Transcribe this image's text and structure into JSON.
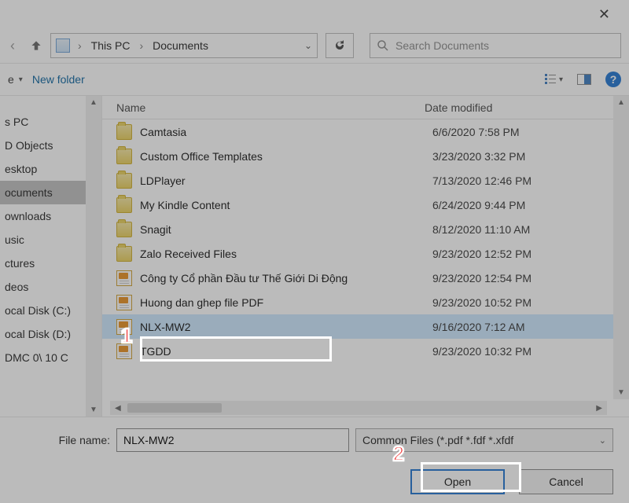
{
  "breadcrumb": {
    "root": "This PC",
    "current": "Documents"
  },
  "search": {
    "placeholder": "Search Documents"
  },
  "toolbar": {
    "organize_exists": true,
    "new_folder": "New folder"
  },
  "columns": {
    "name": "Name",
    "date": "Date modified"
  },
  "tree": {
    "items": [
      {
        "label": "s PC",
        "selected": false
      },
      {
        "label": "D Objects",
        "selected": false
      },
      {
        "label": "esktop",
        "selected": false
      },
      {
        "label": "ocuments",
        "selected": true
      },
      {
        "label": "ownloads",
        "selected": false
      },
      {
        "label": "usic",
        "selected": false
      },
      {
        "label": "ctures",
        "selected": false
      },
      {
        "label": "deos",
        "selected": false
      },
      {
        "label": "ocal Disk (C:)",
        "selected": false
      },
      {
        "label": "ocal Disk (D:)",
        "selected": false
      },
      {
        "label": "DMC 0\\ 10 C",
        "selected": false
      }
    ]
  },
  "files": [
    {
      "type": "folder",
      "name": "Camtasia",
      "date": "6/6/2020 7:58 PM",
      "selected": false
    },
    {
      "type": "folder",
      "name": "Custom Office Templates",
      "date": "3/23/2020 3:32 PM",
      "selected": false
    },
    {
      "type": "folder",
      "name": "LDPlayer",
      "date": "7/13/2020 12:46 PM",
      "selected": false
    },
    {
      "type": "folder",
      "name": "My Kindle Content",
      "date": "6/24/2020 9:44 PM",
      "selected": false
    },
    {
      "type": "folder",
      "name": "Snagit",
      "date": "8/12/2020 11:10 AM",
      "selected": false
    },
    {
      "type": "folder",
      "name": "Zalo Received Files",
      "date": "9/23/2020 12:52 PM",
      "selected": false
    },
    {
      "type": "pdf",
      "name": "Công ty Cổ phần Đầu tư Thế Giới Di Động",
      "date": "9/23/2020 12:54 PM",
      "selected": false
    },
    {
      "type": "pdf",
      "name": "Huong dan ghep file PDF",
      "date": "9/23/2020 10:52 PM",
      "selected": false
    },
    {
      "type": "pdf",
      "name": "NLX-MW2",
      "date": "9/16/2020 7:12 AM",
      "selected": true
    },
    {
      "type": "pdf",
      "name": "TGDD",
      "date": "9/23/2020 10:32 PM",
      "selected": false
    }
  ],
  "footer": {
    "label": "File name:",
    "value": "NLX-MW2",
    "filter": "Common Files (*.pdf *.fdf *.xfdf",
    "open": "Open",
    "cancel": "Cancel"
  },
  "callouts": {
    "one": "1",
    "two": "2"
  }
}
